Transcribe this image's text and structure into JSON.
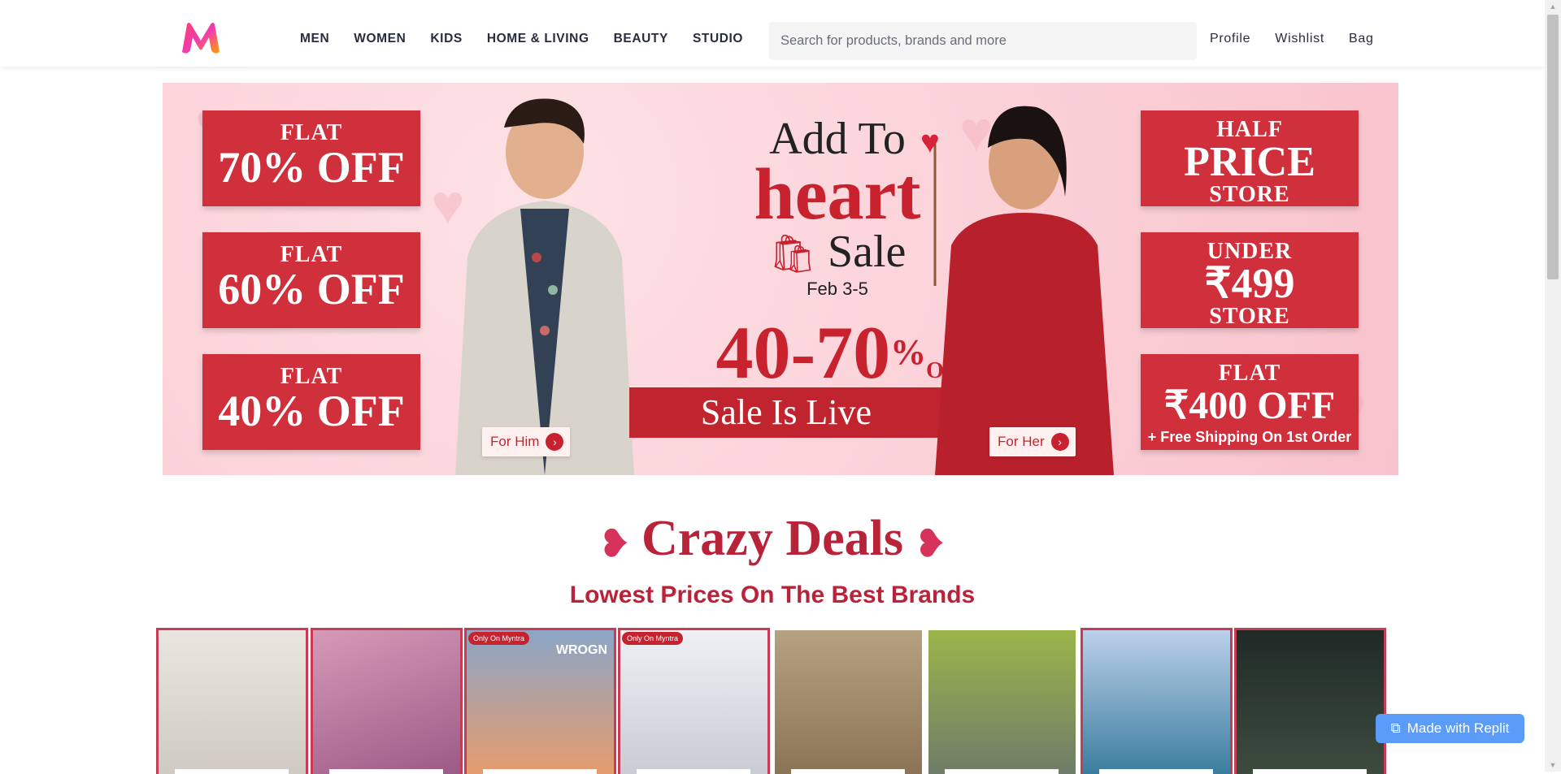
{
  "brand": {
    "logo": "myntra-logo-icon"
  },
  "nav": [
    "MEN",
    "WOMEN",
    "KIDS",
    "HOME & LIVING",
    "BEAUTY",
    "STUDIO"
  ],
  "search": {
    "placeholder": "Search for products, brands and more",
    "icon": "search-icon"
  },
  "actions": {
    "profile": "Profile",
    "wishlist": "Wishlist",
    "bag": "Bag"
  },
  "hero": {
    "offers_left": [
      {
        "top": "FLAT",
        "big": "70% OFF"
      },
      {
        "top": "FLAT",
        "big": "60% OFF"
      },
      {
        "top": "FLAT",
        "big": "40% OFF"
      }
    ],
    "offers_right": [
      {
        "top": "HALF",
        "big": "PRICE",
        "bottom": "STORE"
      },
      {
        "top": "UNDER",
        "big": "₹499",
        "bottom": "STORE"
      },
      {
        "top": "FLAT",
        "big": "₹400 OFF",
        "bottom": "+ Free Shipping On 1st Order"
      }
    ],
    "title_line1": "Add To",
    "title_line2": "heart",
    "title_line3": "Sale",
    "date": "Feb 3-5",
    "range": "40-70",
    "range_pct": "%",
    "range_off": "Off",
    "live": "Sale Is Live",
    "cta_him": "For Him",
    "cta_her": "For Her"
  },
  "deals": {
    "title": "Crazy Deals",
    "subtitle": "Lowest Prices On The Best Brands",
    "cards": [
      {
        "name": "deal-card-1",
        "badge": "",
        "brand": ""
      },
      {
        "name": "deal-card-2",
        "badge": "",
        "brand": ""
      },
      {
        "name": "deal-card-3",
        "badge": "Only On Myntra",
        "brand": "WROGN"
      },
      {
        "name": "deal-card-4",
        "badge": "Only On Myntra",
        "brand": ""
      },
      {
        "name": "deal-card-5",
        "badge": "",
        "brand": ""
      },
      {
        "name": "deal-card-6",
        "badge": "",
        "brand": ""
      },
      {
        "name": "deal-card-7",
        "badge": "",
        "brand": ""
      },
      {
        "name": "deal-card-8",
        "badge": "",
        "brand": ""
      }
    ]
  },
  "replit": {
    "label": "Made with Replit"
  },
  "colors": {
    "accent": "#c8222f",
    "deals": "#b9233a",
    "replit": "#5a9cf8"
  }
}
